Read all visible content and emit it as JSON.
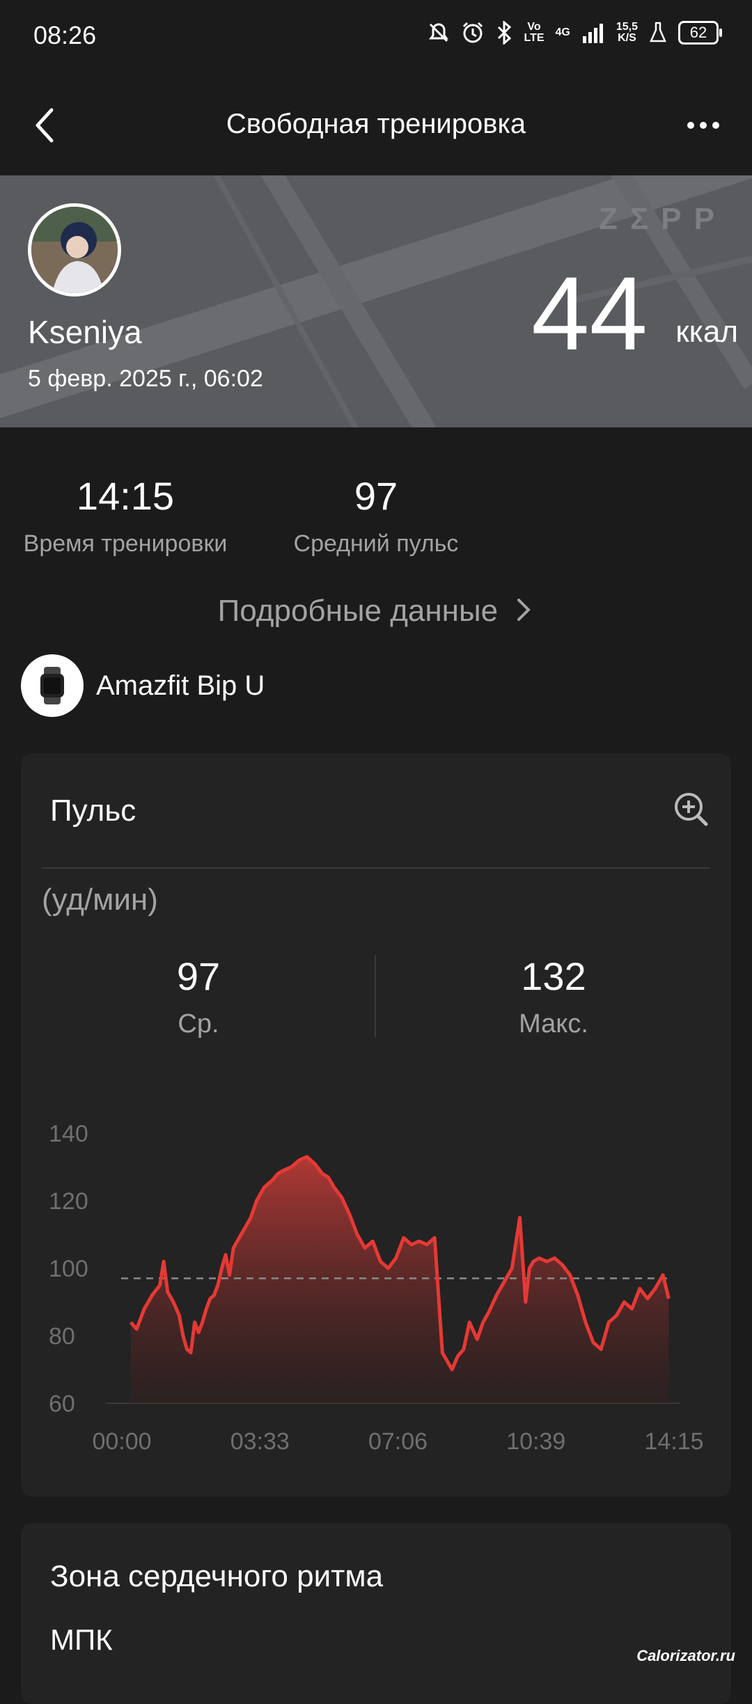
{
  "status_bar": {
    "time": "08:26",
    "net_volte_top": "Vo",
    "net_volte_bottom": "LTE",
    "net_4g": "4G",
    "speed_top": "15,5",
    "speed_bottom": "K/S",
    "battery": "62"
  },
  "header": {
    "title": "Свободная тренировка"
  },
  "banner": {
    "username": "Kseniya",
    "date": "5 февр. 2025 г., 06:02",
    "brand": "ZΣPP",
    "calories": "44",
    "calories_unit": "ккал"
  },
  "summary": {
    "workout_time": "14:15",
    "workout_time_label": "Время тренировки",
    "avg_pulse": "97",
    "avg_pulse_label": "Средний пульс",
    "details_link": "Подробные данные"
  },
  "device": {
    "name": "Amazfit Bip U"
  },
  "pulse_card": {
    "title": "Пульс",
    "unit": "(уд/мин)",
    "avg_value": "97",
    "avg_label": "Ср.",
    "max_value": "132",
    "max_label": "Макс."
  },
  "chart_data": {
    "type": "area",
    "ylim": [
      60,
      140
    ],
    "yticks": [
      "140",
      "120",
      "100",
      "80",
      "60"
    ],
    "xticks": [
      "00:00",
      "03:33",
      "07:06",
      "10:39",
      "14:15"
    ],
    "xrange_minutes": [
      0,
      14.25
    ],
    "average_line": 97,
    "line_color": "#e53935",
    "x": [
      0.25,
      0.4,
      0.6,
      0.8,
      1.0,
      1.1,
      1.2,
      1.35,
      1.5,
      1.6,
      1.7,
      1.8,
      1.9,
      2.0,
      2.1,
      2.2,
      2.3,
      2.4,
      2.5,
      2.6,
      2.7,
      2.8,
      2.9,
      3.0,
      3.1,
      3.2,
      3.35,
      3.5,
      3.7,
      3.9,
      4.05,
      4.2,
      4.4,
      4.6,
      4.8,
      5.0,
      5.2,
      5.35,
      5.5,
      5.7,
      5.9,
      6.1,
      6.3,
      6.5,
      6.7,
      6.9,
      7.1,
      7.3,
      7.5,
      7.7,
      7.9,
      8.1,
      8.3,
      8.45,
      8.55,
      8.7,
      8.85,
      9.0,
      9.2,
      9.35,
      9.5,
      9.7,
      9.9,
      10.1,
      10.3,
      10.45,
      10.55,
      10.65,
      10.8,
      11.0,
      11.2,
      11.4,
      11.6,
      11.8,
      12.0,
      12.2,
      12.4,
      12.6,
      12.8,
      13.0,
      13.2,
      13.4,
      13.6,
      13.8,
      14.0,
      14.15
    ],
    "values": [
      84,
      82,
      88,
      92,
      95,
      102,
      93,
      90,
      86,
      80,
      76,
      75,
      84,
      81,
      84,
      88,
      91,
      92,
      95,
      100,
      104,
      98,
      106,
      108,
      110,
      112,
      115,
      120,
      124,
      126,
      128,
      129,
      130,
      132,
      133,
      131,
      128,
      127,
      124,
      121,
      116,
      110,
      106,
      108,
      102,
      100,
      103,
      109,
      107,
      108,
      107,
      109,
      75,
      72,
      70,
      74,
      76,
      84,
      79,
      84,
      87,
      92,
      96,
      100,
      115,
      90,
      100,
      102,
      103,
      102,
      103,
      101,
      98,
      92,
      84,
      78,
      76,
      84,
      86,
      90,
      88,
      94,
      91,
      94,
      98,
      91
    ]
  },
  "zone_card": {
    "title": "Зона сердечного ритма",
    "subtitle": "МПК"
  },
  "watermark": "Calorizator.ru"
}
